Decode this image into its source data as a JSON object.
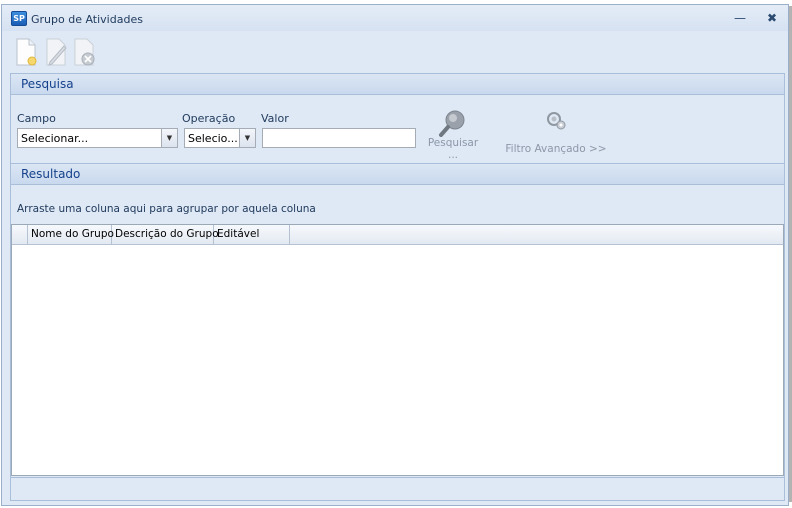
{
  "window": {
    "title": "Grupo de Atividades",
    "app_icon_text": "SP",
    "minimize_glyph": "—",
    "close_glyph": "✖"
  },
  "toolbar": {
    "buttons": [
      {
        "name": "new",
        "icon": "new-document-icon"
      },
      {
        "name": "edit",
        "icon": "pencil-icon"
      },
      {
        "name": "delete",
        "icon": "delete-icon"
      }
    ]
  },
  "pesquisa": {
    "header": "Pesquisa",
    "campo_label": "Campo",
    "operacao_label": "Operação",
    "valor_label": "Valor",
    "campo_selected": "Selecionar...",
    "operacao_selected": "Selecio...",
    "valor_value": "",
    "search_label_1": "Pesquisar",
    "search_label_2": "...",
    "advanced_label": "Filtro Avançado >>"
  },
  "resultado": {
    "header": "Resultado",
    "group_hint": "Arraste uma coluna aqui para agrupar por aquela coluna",
    "columns": [
      "Nome do Grupo",
      "Descrição do Grupo",
      "Editável"
    ]
  },
  "colors": {
    "window_bg": "#dfe8f5",
    "header_text": "#15428b",
    "disabled_text": "#8c98a8"
  }
}
